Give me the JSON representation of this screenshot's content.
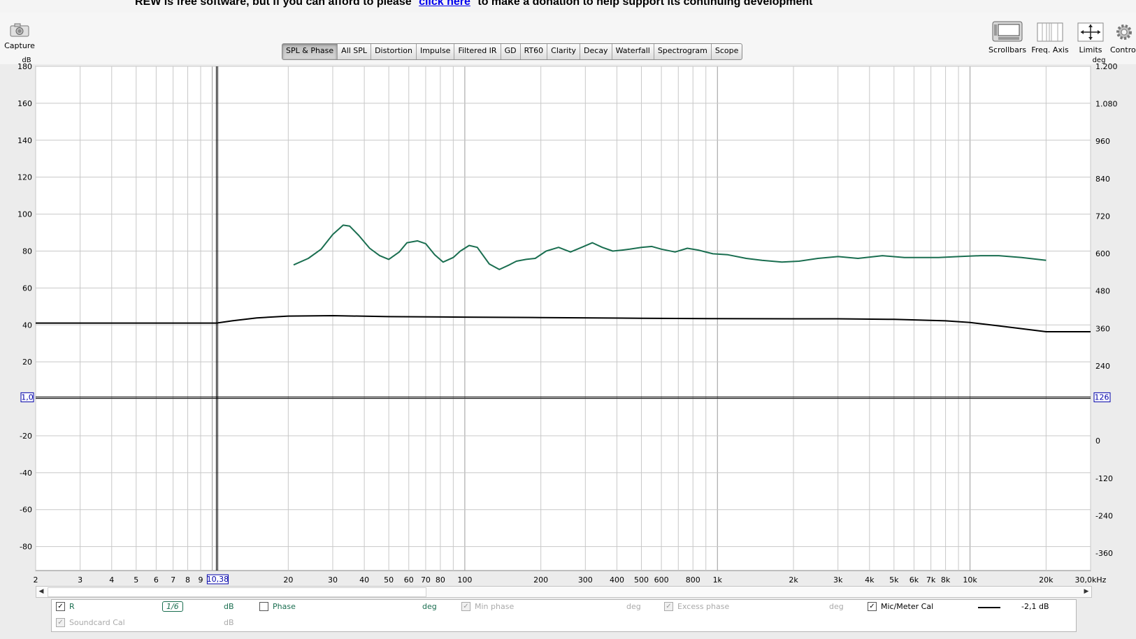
{
  "banner": {
    "prefix": "REW is free software, but if you can afford to please",
    "link": "click here",
    "suffix": "to make a donation to help support its continuing development"
  },
  "toolbar": {
    "capture_label": "Capture",
    "scrollbars_label": "Scrollbars",
    "freq_axis_label": "Freq. Axis",
    "limits_label": "Limits",
    "controls_label": "Controls"
  },
  "tabs": [
    "SPL & Phase",
    "All SPL",
    "Distortion",
    "Impulse",
    "Filtered IR",
    "GD",
    "RT60",
    "Clarity",
    "Decay",
    "Waterfall",
    "Spectrogram",
    "Scope"
  ],
  "active_tab": "SPL & Phase",
  "legend": {
    "r_label": "R",
    "smoothing": "1/6",
    "db_unit": "dB",
    "phase_label": "Phase",
    "deg_unit": "deg",
    "min_phase_label": "Min phase",
    "excess_phase_label": "Excess phase",
    "mic_cal_label": "Mic/Meter Cal",
    "mic_cal_value": "-2,1 dB",
    "soundcard_cal_label": "Soundcard Cal"
  },
  "colors": {
    "r_trace": "#1a6e50",
    "cal_trace": "#000000",
    "grid": "#c8c8c8",
    "plot_bg": "#ffffff"
  },
  "chart_data": {
    "type": "line",
    "xscale": "log",
    "xlim": [
      2,
      30000
    ],
    "ylim": [
      -93,
      180
    ],
    "y2lim": [
      -415.8,
      1200
    ],
    "ylabel": "dB",
    "y2label": "deg",
    "x_tick_labels": [
      {
        "v": 2,
        "t": "2"
      },
      {
        "v": 3,
        "t": "3"
      },
      {
        "v": 4,
        "t": "4"
      },
      {
        "v": 5,
        "t": "5"
      },
      {
        "v": 6,
        "t": "6"
      },
      {
        "v": 7,
        "t": "7"
      },
      {
        "v": 8,
        "t": "8"
      },
      {
        "v": 9,
        "t": "9"
      },
      {
        "v": 20,
        "t": "20"
      },
      {
        "v": 30,
        "t": "30"
      },
      {
        "v": 40,
        "t": "40"
      },
      {
        "v": 50,
        "t": "50"
      },
      {
        "v": 60,
        "t": "60"
      },
      {
        "v": 70,
        "t": "70"
      },
      {
        "v": 80,
        "t": "80"
      },
      {
        "v": 100,
        "t": "100"
      },
      {
        "v": 200,
        "t": "200"
      },
      {
        "v": 300,
        "t": "300"
      },
      {
        "v": 400,
        "t": "400"
      },
      {
        "v": 500,
        "t": "500"
      },
      {
        "v": 600,
        "t": "600"
      },
      {
        "v": 800,
        "t": "800"
      },
      {
        "v": 1000,
        "t": "1k"
      },
      {
        "v": 2000,
        "t": "2k"
      },
      {
        "v": 3000,
        "t": "3k"
      },
      {
        "v": 4000,
        "t": "4k"
      },
      {
        "v": 5000,
        "t": "5k"
      },
      {
        "v": 6000,
        "t": "6k"
      },
      {
        "v": 7000,
        "t": "7k"
      },
      {
        "v": 8000,
        "t": "8k"
      },
      {
        "v": 10000,
        "t": "10k"
      },
      {
        "v": 20000,
        "t": "20k"
      },
      {
        "v": 30000,
        "t": "30,0kHz"
      }
    ],
    "y_ticks": [
      180,
      160,
      140,
      120,
      100,
      80,
      60,
      40,
      20,
      -20,
      -40,
      -60,
      -80
    ],
    "y2_ticks": [
      {
        "v": 1200,
        "t": "1.200"
      },
      {
        "v": 1080,
        "t": "1.080"
      },
      {
        "v": 960,
        "t": "960"
      },
      {
        "v": 840,
        "t": "840"
      },
      {
        "v": 720,
        "t": "720"
      },
      {
        "v": 600,
        "t": "600"
      },
      {
        "v": 480,
        "t": "480"
      },
      {
        "v": 360,
        "t": "360"
      },
      {
        "v": 240,
        "t": "240"
      },
      {
        "v": 0,
        "t": "0"
      },
      {
        "v": -120,
        "t": "-120"
      },
      {
        "v": -240,
        "t": "-240"
      },
      {
        "v": -360,
        "t": "-360"
      }
    ],
    "cursor": {
      "x": 10.38,
      "x_label": "10,38",
      "y": 1.0,
      "y_label": "1,0",
      "y2_label": "126"
    },
    "series": [
      {
        "name": "R",
        "color": "#1a6e50",
        "x": [
          21,
          24,
          27,
          30,
          33,
          35,
          38,
          42,
          46,
          50,
          55,
          59,
          65,
          70,
          76,
          82,
          90,
          96,
          104,
          112,
          125,
          137,
          150,
          160,
          175,
          190,
          210,
          235,
          262,
          290,
          320,
          350,
          385,
          420,
          450,
          500,
          550,
          600,
          680,
          760,
          840,
          960,
          1100,
          1300,
          1500,
          1800,
          2100,
          2500,
          3000,
          3600,
          4500,
          5500,
          6500,
          7500,
          9000,
          11000,
          13000,
          16000,
          20000
        ],
        "y": [
          72.5,
          76,
          81,
          89,
          94,
          93.5,
          88.5,
          81.5,
          77.5,
          75.5,
          79.5,
          84.5,
          85.5,
          84,
          78,
          74,
          76.5,
          80,
          83,
          82,
          73,
          70,
          72.5,
          74.5,
          75.5,
          76,
          80,
          82,
          79.5,
          82,
          84.5,
          82,
          80,
          80.5,
          81,
          82,
          82.5,
          81,
          79.5,
          81.5,
          80.5,
          78.5,
          78,
          76,
          75,
          74,
          74.5,
          76,
          77,
          76,
          77.5,
          76.5,
          76.5,
          76.5,
          77,
          77.5,
          77.5,
          76.5,
          75
        ]
      },
      {
        "name": "Mic/Meter Cal",
        "color": "#000000",
        "x": [
          2,
          6,
          10.4,
          12,
          15,
          20,
          30,
          50,
          100,
          200,
          500,
          1000,
          2000,
          3000,
          5000,
          8000,
          10000,
          13000,
          20000,
          30000
        ],
        "y": [
          41,
          41,
          41,
          42.2,
          43.8,
          44.8,
          45,
          44.5,
          44.2,
          44,
          43.6,
          43.4,
          43.3,
          43.3,
          43,
          42.2,
          41.3,
          39.5,
          36.3,
          36.3
        ]
      }
    ]
  }
}
